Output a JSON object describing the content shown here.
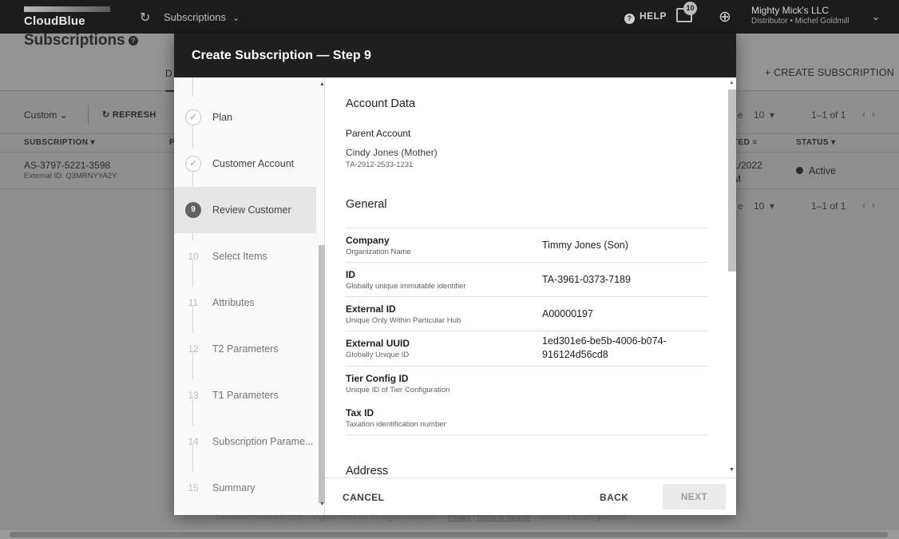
{
  "topbar": {
    "logo": "CloudBlue",
    "app_menu": "Subscriptions",
    "help": "HELP",
    "notifications_count": "10",
    "account_name": "Mighty Mick's LLC",
    "account_sub": "Distributor • Michel Goldmill"
  },
  "page": {
    "title": "Subscriptions",
    "tab_partial": "D",
    "create_button": "+ CREATE SUBSCRIPTION",
    "filter_button": "Custom",
    "refresh_button": "REFRESH",
    "pager": {
      "size_label": "e",
      "size": "10",
      "range": "1–1 of 1"
    },
    "columns": {
      "subscription": "SUBSCRIPTION",
      "p": "P",
      "created": "TED",
      "status": "STATUS"
    },
    "rows": [
      {
        "id": "AS-3797-5221-3598",
        "external": "External ID: Q3MRNYYA2Y",
        "date": "1/2022",
        "time": "M",
        "status": "Active"
      }
    ],
    "footer": "CloudBlue Connect © 2022 — Ingram Micro Inc. All Rights Reserved. — ",
    "footer_privacy": "Privacy",
    "footer_terms": "Terms of Service",
    "footer_version": " · Version 24.0.1399-g8c83c5f"
  },
  "modal": {
    "title": "Create Subscription — Step 9",
    "steps": [
      {
        "num": "",
        "label": "Plan",
        "state": "done"
      },
      {
        "num": "",
        "label": "Customer Account",
        "state": "done"
      },
      {
        "num": "9",
        "label": "Review Customer",
        "state": "current"
      },
      {
        "num": "10",
        "label": "Select Items",
        "state": "todo"
      },
      {
        "num": "11",
        "label": "Attributes",
        "state": "todo"
      },
      {
        "num": "12",
        "label": "T2 Parameters",
        "state": "todo"
      },
      {
        "num": "13",
        "label": "T1 Parameters",
        "state": "todo"
      },
      {
        "num": "14",
        "label": "Subscription Parame...",
        "state": "todo"
      },
      {
        "num": "15",
        "label": "Summary",
        "state": "todo"
      }
    ],
    "account_data": {
      "title": "Account Data",
      "parent_label": "Parent Account",
      "parent_name": "Cindy Jones (Mother)",
      "parent_id": "TA-2912-2533-1231"
    },
    "general": {
      "title": "General",
      "fields": [
        {
          "name": "Company",
          "desc": "Organization Name",
          "value": "Timmy Jones (Son)"
        },
        {
          "name": "ID",
          "desc": "Globally unique immutable identifier",
          "value": "TA-3961-0373-7189"
        },
        {
          "name": "External ID",
          "desc": "Unique Only Within Particular Hub",
          "value": "A00000197"
        },
        {
          "name": "External UUID",
          "desc": "Globally Unique ID",
          "value": "1ed301e6-be5b-4006-b074-",
          "value2": "916124d56cd8"
        },
        {
          "name": "Tier Config ID",
          "desc": "Unique ID of Tier Configuration",
          "value": ""
        },
        {
          "name": "Tax ID",
          "desc": "Taxation identification number",
          "value": ""
        }
      ]
    },
    "address_title": "Address",
    "buttons": {
      "cancel": "CANCEL",
      "back": "BACK",
      "next": "NEXT"
    }
  }
}
